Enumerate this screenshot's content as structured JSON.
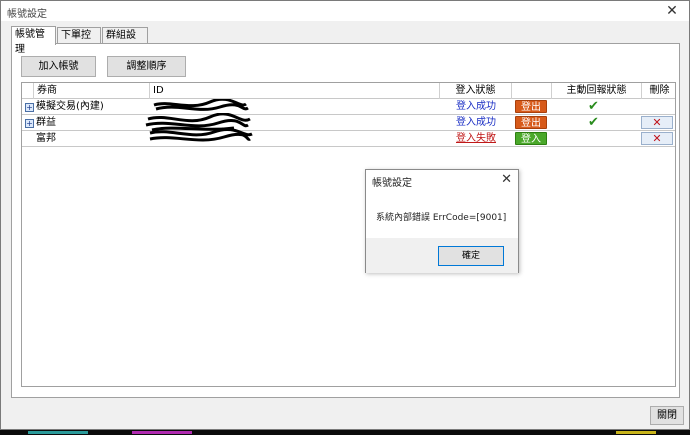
{
  "window": {
    "title": "帳號設定",
    "close_glyph": "✕"
  },
  "tabs": [
    {
      "label": "帳號管理",
      "active": true
    },
    {
      "label": "下單控管",
      "active": false
    },
    {
      "label": "群組設定",
      "active": false
    }
  ],
  "toolbar": {
    "add_label": "加入帳號",
    "reorder_label": "調整順序"
  },
  "grid": {
    "columns": [
      "券商",
      "ID",
      "登入狀態",
      "",
      "主動回報狀態",
      "刪除"
    ],
    "rows": [
      {
        "broker": "模擬交易(內建)",
        "expander": "+",
        "status": "登入成功",
        "action": "登出",
        "report_ok": true,
        "deletable": false
      },
      {
        "broker": "群益",
        "expander": "+",
        "status": "登入成功",
        "action": "登出",
        "report_ok": true,
        "deletable": true
      },
      {
        "broker": "富邦",
        "expander": "",
        "status": "登入失敗",
        "action": "登入",
        "report_ok": false,
        "deletable": true
      }
    ],
    "check_glyph": "✔",
    "delete_glyph": "✕"
  },
  "dialog": {
    "title": "帳號設定",
    "close_glyph": "✕",
    "message": "系統內部錯誤 ErrCode=[9001]",
    "ok_label": "確定"
  },
  "footer": {
    "close_label": "關閉"
  },
  "colors": {
    "logout_badge": "#d75a1a",
    "login_badge": "#4aa82a",
    "status_ok": "#1a2ec4",
    "status_fail": "#c01818",
    "check": "#2a8c1e",
    "delete": "#c0141c"
  },
  "icons": {
    "expander": "expand-plus-icon",
    "check": "checkmark-icon",
    "delete": "delete-x-icon",
    "close": "close-icon"
  }
}
